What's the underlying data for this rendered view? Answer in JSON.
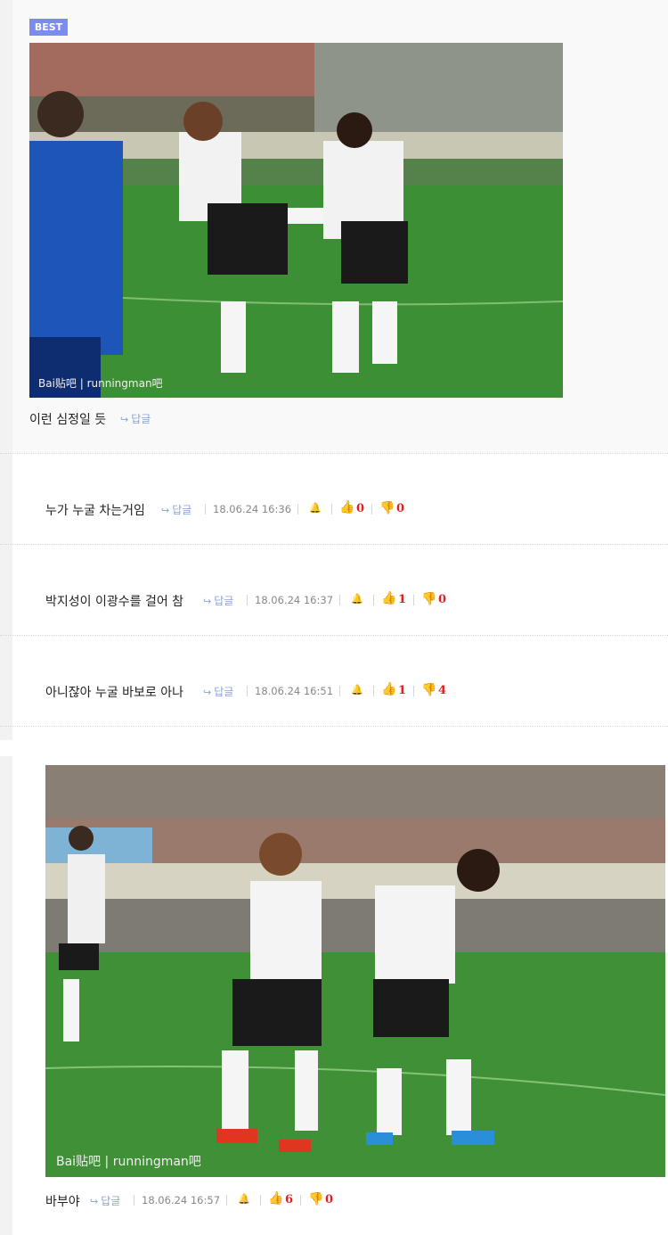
{
  "best": {
    "badge": "BEST",
    "image_watermark": "Bai贴吧 | runningman吧",
    "comment": "이런 심정일 듯",
    "reply_label": "답글"
  },
  "comments": [
    {
      "text": "누가 누굴 차는거임",
      "reply_label": "답글",
      "timestamp": "18.06.24 16:36",
      "likes": "0",
      "dislikes": "0"
    },
    {
      "text": "박지성이 이광수를 걸어 참",
      "reply_label": "답글",
      "timestamp": "18.06.24 16:37",
      "likes": "1",
      "dislikes": "0"
    },
    {
      "text": "아니잖아 누굴 바보로 아나",
      "reply_label": "답글",
      "timestamp": "18.06.24 16:51",
      "likes": "1",
      "dislikes": "4"
    }
  ],
  "last_comment": {
    "image_watermark": "Bai贴吧 | runningman吧",
    "text": "바부야",
    "reply_label": "답글",
    "timestamp": "18.06.24 16:57",
    "likes": "6",
    "dislikes": "0"
  },
  "icons": {
    "reply": "reply-arrow-icon",
    "report": "bell-icon",
    "like": "thumbs-up-icon",
    "dislike": "thumbs-down-icon"
  },
  "colors": {
    "badge": "#7b8cf0",
    "reply": "#8aa4d6",
    "like_icon": "#2d6fd8",
    "count": "#e02020"
  }
}
